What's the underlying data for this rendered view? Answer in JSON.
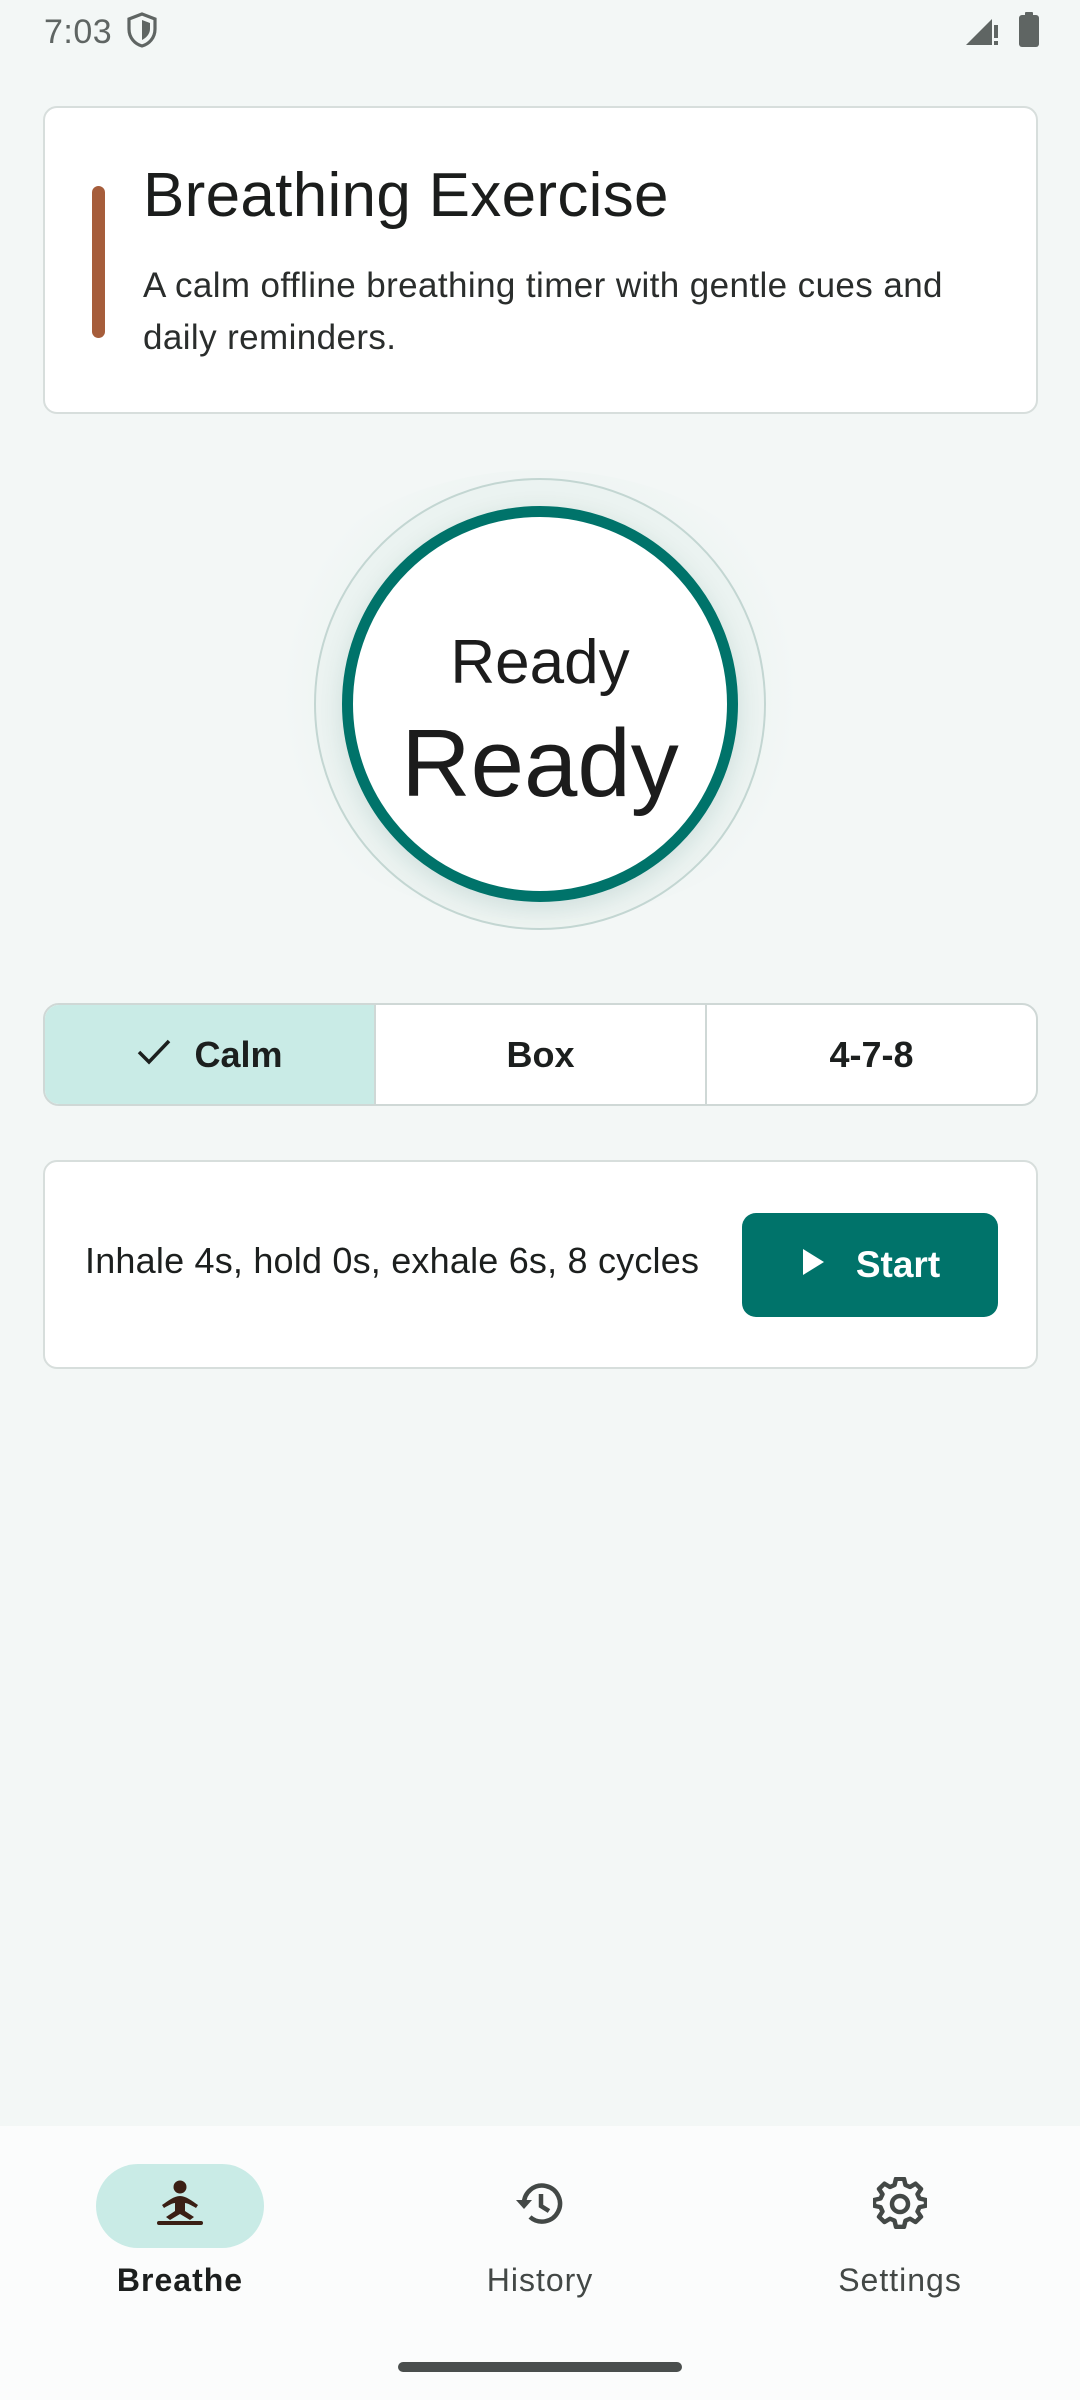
{
  "status_bar": {
    "time": "7:03",
    "icons": [
      "shield-icon",
      "signal-icon",
      "battery-icon"
    ]
  },
  "header": {
    "title": "Breathing Exercise",
    "subtitle": "A calm offline breathing timer with gentle cues and daily reminders.",
    "accent_color": "#a65d3b"
  },
  "breath_circle": {
    "phase_label": "Ready",
    "count_label": "Ready",
    "ring_color": "#00736a"
  },
  "patterns": {
    "options": [
      "Calm",
      "Box",
      "4-7-8"
    ],
    "selected": "Calm",
    "selected_icon": "check-icon"
  },
  "session": {
    "description": "Inhale 4s, hold 0s, exhale 6s, 8 cycles",
    "start_label": "Start",
    "start_icon": "play-icon"
  },
  "bottom_nav": {
    "items": [
      {
        "label": "Breathe",
        "icon": "meditation-icon",
        "active": true
      },
      {
        "label": "History",
        "icon": "history-icon",
        "active": false
      },
      {
        "label": "Settings",
        "icon": "gear-icon",
        "active": false
      }
    ]
  },
  "colors": {
    "primary": "#00736a",
    "selected_bg": "#c9ebe6",
    "background": "#f3f7f6"
  }
}
